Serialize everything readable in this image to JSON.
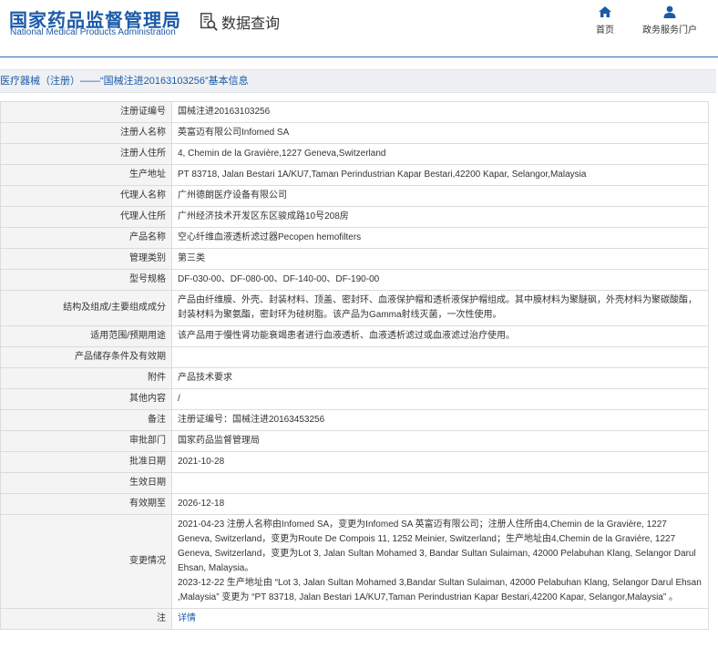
{
  "header": {
    "logo_cn": "国家药品监督管理局",
    "logo_en": "National Medical Products Administration",
    "query_label": "数据查询",
    "nav": [
      {
        "label": "首页",
        "icon": "home-icon"
      },
      {
        "label": "政务服务门户",
        "icon": "user-icon"
      }
    ],
    "accent": "#1b5ba8"
  },
  "title": "医疗器械（注册）——“国械注进20163103256”基本信息",
  "rows": [
    {
      "label": "注册证编号",
      "value": "国械注进20163103256"
    },
    {
      "label": "注册人名称",
      "value": "英富迈有限公司Infomed SA"
    },
    {
      "label": "注册人住所",
      "value": "4, Chemin de la Gravière,1227 Geneva,Switzerland"
    },
    {
      "label": "生产地址",
      "value": "PT 83718, Jalan Bestari 1A/KU7,Taman Perindustrian Kapar Bestari,42200 Kapar, Selangor,Malaysia"
    },
    {
      "label": "代理人名称",
      "value": "广州德朗医疗设备有限公司"
    },
    {
      "label": "代理人住所",
      "value": "广州经济技术开发区东区骏成路10号208房"
    },
    {
      "label": "产品名称",
      "value": "空心纤维血液透析滤过器Pecopen hemofilters"
    },
    {
      "label": "管理类别",
      "value": "第三类"
    },
    {
      "label": "型号规格",
      "value": "DF-030-00、DF-080-00、DF-140-00、DF-190-00"
    },
    {
      "label": "结构及组成/主要组成成分",
      "value": "产品由纤维膜、外壳、封装材料、顶盖、密封环、血液保护帽和透析液保护帽组成。其中膜材料为聚醚砜，外壳材料为聚碳酸酯，封装材料为聚氨酯，密封环为硅树脂。该产品为Gamma射线灭菌，一次性使用。"
    },
    {
      "label": "适用范围/预期用途",
      "value": "该产品用于慢性肾功能衰竭患者进行血液透析、血液透析滤过或血液滤过治疗使用。"
    },
    {
      "label": "产品储存条件及有效期",
      "value": ""
    },
    {
      "label": "附件",
      "value": "产品技术要求"
    },
    {
      "label": "其他内容",
      "value": "/"
    },
    {
      "label": "备注",
      "value": "注册证编号：国械注进20163453256"
    },
    {
      "label": "审批部门",
      "value": "国家药品监督管理局"
    },
    {
      "label": "批准日期",
      "value": "2021-10-28"
    },
    {
      "label": "生效日期",
      "value": ""
    },
    {
      "label": "有效期至",
      "value": "2026-12-18"
    },
    {
      "label": "变更情况",
      "value": "2021-04-23 注册人名称由Infomed SA，变更为Infomed SA 英富迈有限公司；注册人住所由4,Chemin de la Gravière, 1227 Geneva, Switzerland，变更为Route De Compois 11, 1252 Meinier, Switzerland；生产地址由4,Chemin de la Gravière, 1227 Geneva, Switzerland，变更为Lot 3, Jalan Sultan Mohamed 3, Bandar Sultan Sulaiman, 42000 Pelabuhan Klang, Selangor Darul Ehsan, Malaysia。\n2023-12-22 生产地址由 “Lot 3, Jalan Sultan Mohamed 3,Bandar Sultan Sulaiman, 42000 Pelabuhan Klang, Selangor Darul Ehsan ,Malaysia” 变更为 “PT 83718, Jalan Bestari 1A/KU7,Taman Perindustrian Kapar Bestari,42200 Kapar, Selangor,Malaysia” 。"
    },
    {
      "label": "注",
      "value": "详情",
      "is_link": true
    }
  ]
}
